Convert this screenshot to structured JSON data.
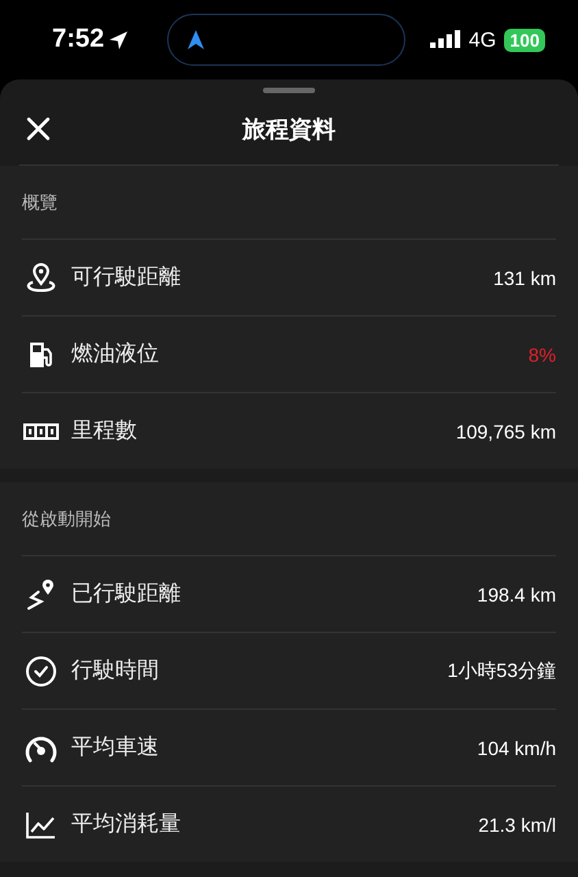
{
  "status_bar": {
    "time": "7:52",
    "network": "4G",
    "battery": "100"
  },
  "header": {
    "title": "旅程資料"
  },
  "sections": [
    {
      "title": "概覽",
      "rows": [
        {
          "label": "可行駛距離",
          "value": "131 km",
          "warning": false
        },
        {
          "label": "燃油液位",
          "value": "8%",
          "warning": true
        },
        {
          "label": "里程數",
          "value": "109,765 km",
          "warning": false
        }
      ]
    },
    {
      "title": "從啟動開始",
      "rows": [
        {
          "label": "已行駛距離",
          "value": "198.4 km",
          "warning": false
        },
        {
          "label": "行駛時間",
          "value": "1小時53分鐘",
          "warning": false
        },
        {
          "label": "平均車速",
          "value": "104 km/h",
          "warning": false
        },
        {
          "label": "平均消耗量",
          "value": "21.3 km/l",
          "warning": false
        }
      ]
    }
  ]
}
